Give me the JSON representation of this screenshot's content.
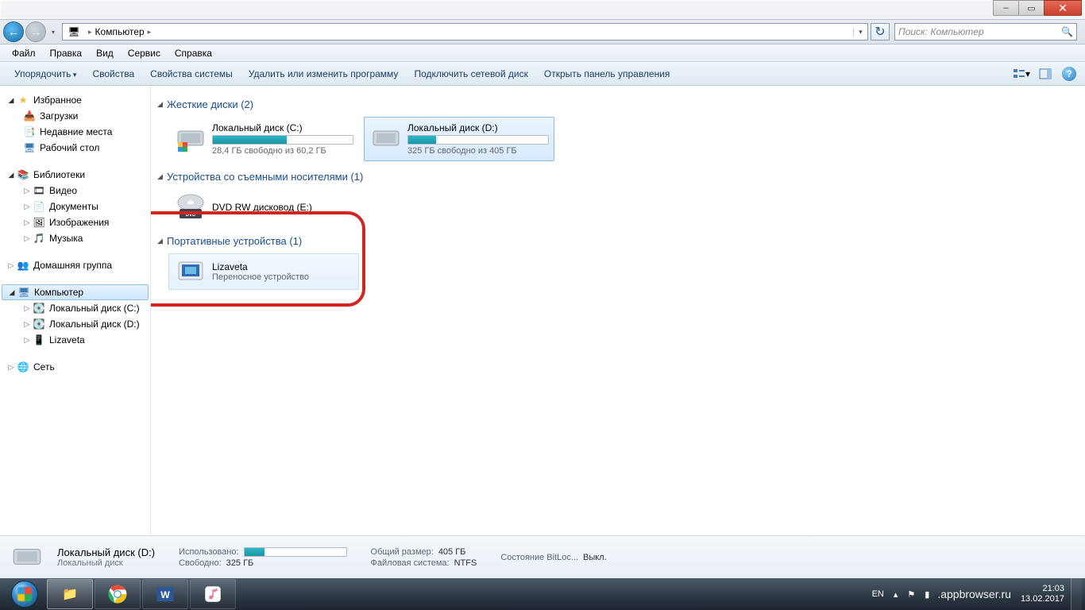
{
  "window_controls": {
    "min": "–",
    "max": "▭",
    "close": "✕"
  },
  "nav": {
    "path_label": "Компьютер",
    "search_placeholder": "Поиск: Компьютер"
  },
  "menu": [
    "Файл",
    "Правка",
    "Вид",
    "Сервис",
    "Справка"
  ],
  "toolbar": {
    "organize": "Упорядочить",
    "items": [
      "Свойства",
      "Свойства системы",
      "Удалить или изменить программу",
      "Подключить сетевой диск",
      "Открыть панель управления"
    ]
  },
  "sidebar": {
    "favorites": {
      "label": "Избранное",
      "items": [
        "Загрузки",
        "Недавние места",
        "Рабочий стол"
      ]
    },
    "libraries": {
      "label": "Библиотеки",
      "items": [
        "Видео",
        "Документы",
        "Изображения",
        "Музыка"
      ]
    },
    "homegroup": {
      "label": "Домашняя группа"
    },
    "computer": {
      "label": "Компьютер",
      "items": [
        "Локальный диск (C:)",
        "Локальный диск (D:)",
        "Lizaveta"
      ]
    },
    "network": {
      "label": "Сеть"
    }
  },
  "groups": {
    "hdd": {
      "title": "Жесткие диски (2)",
      "drives": [
        {
          "name": "Локальный диск (C:)",
          "sub": "28,4 ГБ свободно из 60,2 ГБ",
          "fill": 53
        },
        {
          "name": "Локальный диск (D:)",
          "sub": "325 ГБ свободно из 405 ГБ",
          "fill": 20
        }
      ]
    },
    "removable": {
      "title": "Устройства со съемными носителями (1)",
      "items": [
        {
          "name": "DVD RW дисковод (E:)"
        }
      ]
    },
    "portable": {
      "title": "Портативные устройства (1)",
      "items": [
        {
          "name": "Lizaveta",
          "sub": "Переносное устройство"
        }
      ]
    }
  },
  "details": {
    "title": "Локальный диск (D:)",
    "subtitle": "Локальный диск",
    "used_label": "Использовано:",
    "free_label": "Свободно:",
    "free_val": "325 ГБ",
    "total_label": "Общий размер:",
    "total_val": "405 ГБ",
    "fs_label": "Файловая система:",
    "fs_val": "NTFS",
    "bl_label": "Состояние BitLoc...",
    "bl_val": "Выкл.",
    "fill": 20
  },
  "taskbar": {
    "lang": "EN",
    "time": "21:03",
    "date": "13.02.2017",
    "watermark": ".appbrowser.ru"
  }
}
